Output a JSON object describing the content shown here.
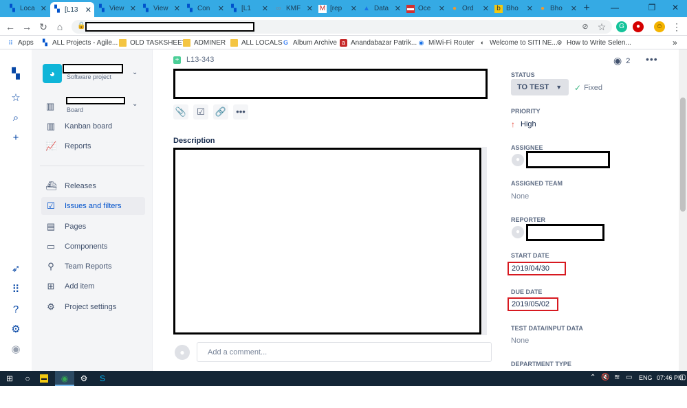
{
  "browser": {
    "tabs": [
      {
        "title": "Loca",
        "icon": "jira-icon",
        "active": false
      },
      {
        "title": "[L13",
        "icon": "jira-icon",
        "active": true
      },
      {
        "title": "View",
        "icon": "jira-icon",
        "active": false
      },
      {
        "title": "View",
        "icon": "jira-icon",
        "active": false
      },
      {
        "title": "Con",
        "icon": "jira-icon",
        "active": false
      },
      {
        "title": "[L1",
        "icon": "jira-icon",
        "active": false
      },
      {
        "title": "KMF",
        "icon": "link-icon",
        "active": false
      },
      {
        "title": "[rep",
        "icon": "gmail-icon",
        "active": false
      },
      {
        "title": "Data",
        "icon": "chart-icon",
        "active": false
      },
      {
        "title": "Oce",
        "icon": "red-bar-icon",
        "active": false
      },
      {
        "title": "Ord",
        "icon": "pin-icon",
        "active": false
      },
      {
        "title": "Bho",
        "icon": "b-icon",
        "active": false
      },
      {
        "title": "Bho",
        "icon": "pin-icon",
        "active": false
      }
    ],
    "bookmarks": [
      {
        "label": "Apps",
        "icon": "apps-grid-icon"
      },
      {
        "label": "ALL Projects - Agile...",
        "icon": "jira-icon"
      },
      {
        "label": "OLD TASKSHEET",
        "icon": "folder-icon"
      },
      {
        "label": "ADMINER",
        "icon": "folder-icon"
      },
      {
        "label": "ALL LOCALS",
        "icon": "folder-icon"
      },
      {
        "label": "Album Archive",
        "icon": "google-icon"
      },
      {
        "label": "Anandabazar Patrik...",
        "icon": "anandabazar-icon"
      },
      {
        "label": "MiWi-Fi Router",
        "icon": "wifi-icon"
      },
      {
        "label": "Welcome to SITI NE...",
        "icon": "siti-icon"
      },
      {
        "label": "How to Write Selen...",
        "icon": "gear-icon"
      }
    ]
  },
  "sidebar": {
    "project_type": "Software project",
    "board_type": "Board",
    "items": [
      {
        "label": "Kanban board",
        "icon": "kanban-icon"
      },
      {
        "label": "Reports",
        "icon": "reports-icon"
      },
      {
        "label": "Releases",
        "icon": "releases-icon"
      },
      {
        "label": "Issues and filters",
        "icon": "issues-icon"
      },
      {
        "label": "Pages",
        "icon": "pages-icon"
      },
      {
        "label": "Components",
        "icon": "components-icon"
      },
      {
        "label": "Team Reports",
        "icon": "team-reports-icon"
      },
      {
        "label": "Add item",
        "icon": "add-item-icon"
      },
      {
        "label": "Project settings",
        "icon": "gear-icon"
      }
    ]
  },
  "issue": {
    "key": "L13-343",
    "description_label": "Description",
    "comment_placeholder": "Add a comment...",
    "watchers": "2"
  },
  "fields": {
    "status_label": "STATUS",
    "status_value": "TO TEST",
    "resolution": "Fixed",
    "priority_label": "PRIORITY",
    "priority_value": "High",
    "assignee_label": "ASSIGNEE",
    "assigned_team_label": "ASSIGNED TEAM",
    "assigned_team_value": "None",
    "reporter_label": "REPORTER",
    "start_date_label": "START DATE",
    "start_date_value": "2019/04/30",
    "due_date_label": "DUE DATE",
    "due_date_value": "2019/05/02",
    "test_data_label": "TEST DATA/INPUT DATA",
    "test_data_value": "None",
    "department_label": "DEPARTMENT TYPE"
  },
  "taskbar": {
    "language": "ENG",
    "time": "07:46 PM"
  },
  "colors": {
    "tabbar": "#35aae4",
    "jira_blue": "#0052cc",
    "redaction_red": "#d71920",
    "taskbar": "#142636"
  }
}
